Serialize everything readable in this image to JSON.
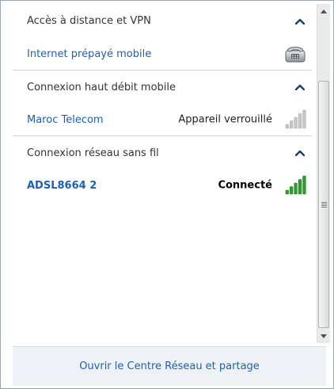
{
  "sections": [
    {
      "title": "Accès à distance et VPN",
      "items": [
        {
          "name": "Internet prépayé mobile",
          "status": "",
          "icon": "phone-modem-icon"
        }
      ]
    },
    {
      "title": "Connexion haut débit mobile",
      "items": [
        {
          "name": "Maroc Telecom",
          "status": "Appareil verrouillé",
          "icon": "signal-strength-icon",
          "signal_bars": 0
        }
      ]
    },
    {
      "title": "Connexion réseau sans fil",
      "items": [
        {
          "name": "ADSL8664 2",
          "status": "Connecté",
          "icon": "signal-strength-icon",
          "signal_bars": 5
        }
      ]
    }
  ],
  "footer": {
    "link": "Ouvrir le Centre Réseau et partage"
  },
  "colors": {
    "link": "#1b61b7",
    "signal_active": "#2e9e2e",
    "signal_inactive": "#c8c8c8",
    "footer_bg": "#eef2f7"
  }
}
